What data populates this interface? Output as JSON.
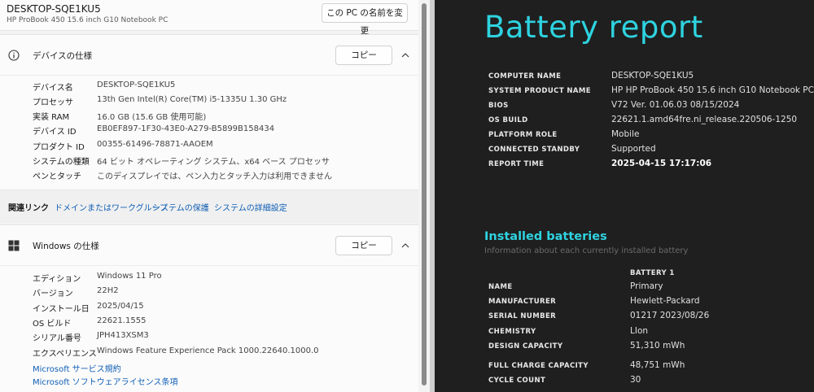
{
  "settings": {
    "device_name": "DESKTOP-SQE1KU5",
    "device_model": "HP ProBook 450 15.6 inch G10 Notebook PC",
    "rename_button": "この PC の名前を変更",
    "device_spec": {
      "title": "デバイスの仕様",
      "copy_label": "コピー",
      "rows": [
        {
          "key": "デバイス名",
          "value": "DESKTOP-SQE1KU5"
        },
        {
          "key": "プロセッサ",
          "value": "13th Gen Intel(R) Core(TM) i5-1335U   1.30 GHz"
        },
        {
          "key": "実装 RAM",
          "value": "16.0 GB (15.6 GB 使用可能)"
        },
        {
          "key": "デバイス ID",
          "value": "EB0EF897-1F30-43E0-A279-B5899B158434"
        },
        {
          "key": "プロダクト ID",
          "value": "00355-61496-78871-AAOEM"
        },
        {
          "key": "システムの種類",
          "value": "64 ビット オペレーティング システム、x64 ベース プロセッサ"
        },
        {
          "key": "ペンとタッチ",
          "value": "このディスプレイでは、ペン入力とタッチ入力は利用できません"
        }
      ]
    },
    "related_links": {
      "label": "関連リンク",
      "links": [
        "ドメインまたはワークグループ",
        "システムの保護",
        "システムの詳細設定"
      ]
    },
    "windows_spec": {
      "title": "Windows の仕様",
      "copy_label": "コピー",
      "rows": [
        {
          "key": "エディション",
          "value": "Windows 11 Pro"
        },
        {
          "key": "バージョン",
          "value": "22H2"
        },
        {
          "key": "インストール日",
          "value": "2025/04/15"
        },
        {
          "key": "OS ビルド",
          "value": "22621.1555"
        },
        {
          "key": "シリアル番号",
          "value": "JPH413XSM3"
        },
        {
          "key": "エクスペリエンス",
          "value": "Windows Feature Experience Pack 1000.22640.1000.0"
        }
      ],
      "links": [
        "Microsoft サービス規約",
        "Microsoft ソフトウェアライセンス条項"
      ]
    }
  },
  "battery_report": {
    "title": "Battery report",
    "system": [
      {
        "key": "COMPUTER NAME",
        "value": "DESKTOP-SQE1KU5"
      },
      {
        "key": "SYSTEM PRODUCT NAME",
        "value": "HP HP ProBook 450 15.6 inch G10 Notebook PC"
      },
      {
        "key": "BIOS",
        "value": "V72 Ver. 01.06.03 08/15/2024"
      },
      {
        "key": "OS BUILD",
        "value": "22621.1.amd64fre.ni_release.220506-1250"
      },
      {
        "key": "PLATFORM ROLE",
        "value": "Mobile"
      },
      {
        "key": "CONNECTED STANDBY",
        "value": "Supported"
      },
      {
        "key": "REPORT TIME",
        "value": "2025-04-15   17:17:06"
      }
    ],
    "installed_title": "Installed batteries",
    "installed_subtitle": "Information about each currently installed battery",
    "battery_header": "BATTERY 1",
    "battery": [
      {
        "key": "NAME",
        "value": "Primary"
      },
      {
        "key": "MANUFACTURER",
        "value": "Hewlett-Packard"
      },
      {
        "key": "SERIAL NUMBER",
        "value": "01217 2023/08/26"
      },
      {
        "key": "CHEMISTRY",
        "value": "LIon"
      },
      {
        "key": "DESIGN CAPACITY",
        "value": "51,310 mWh"
      },
      {
        "key": "FULL CHARGE CAPACITY",
        "value": "48,751 mWh"
      },
      {
        "key": "CYCLE COUNT",
        "value": "30"
      }
    ]
  }
}
